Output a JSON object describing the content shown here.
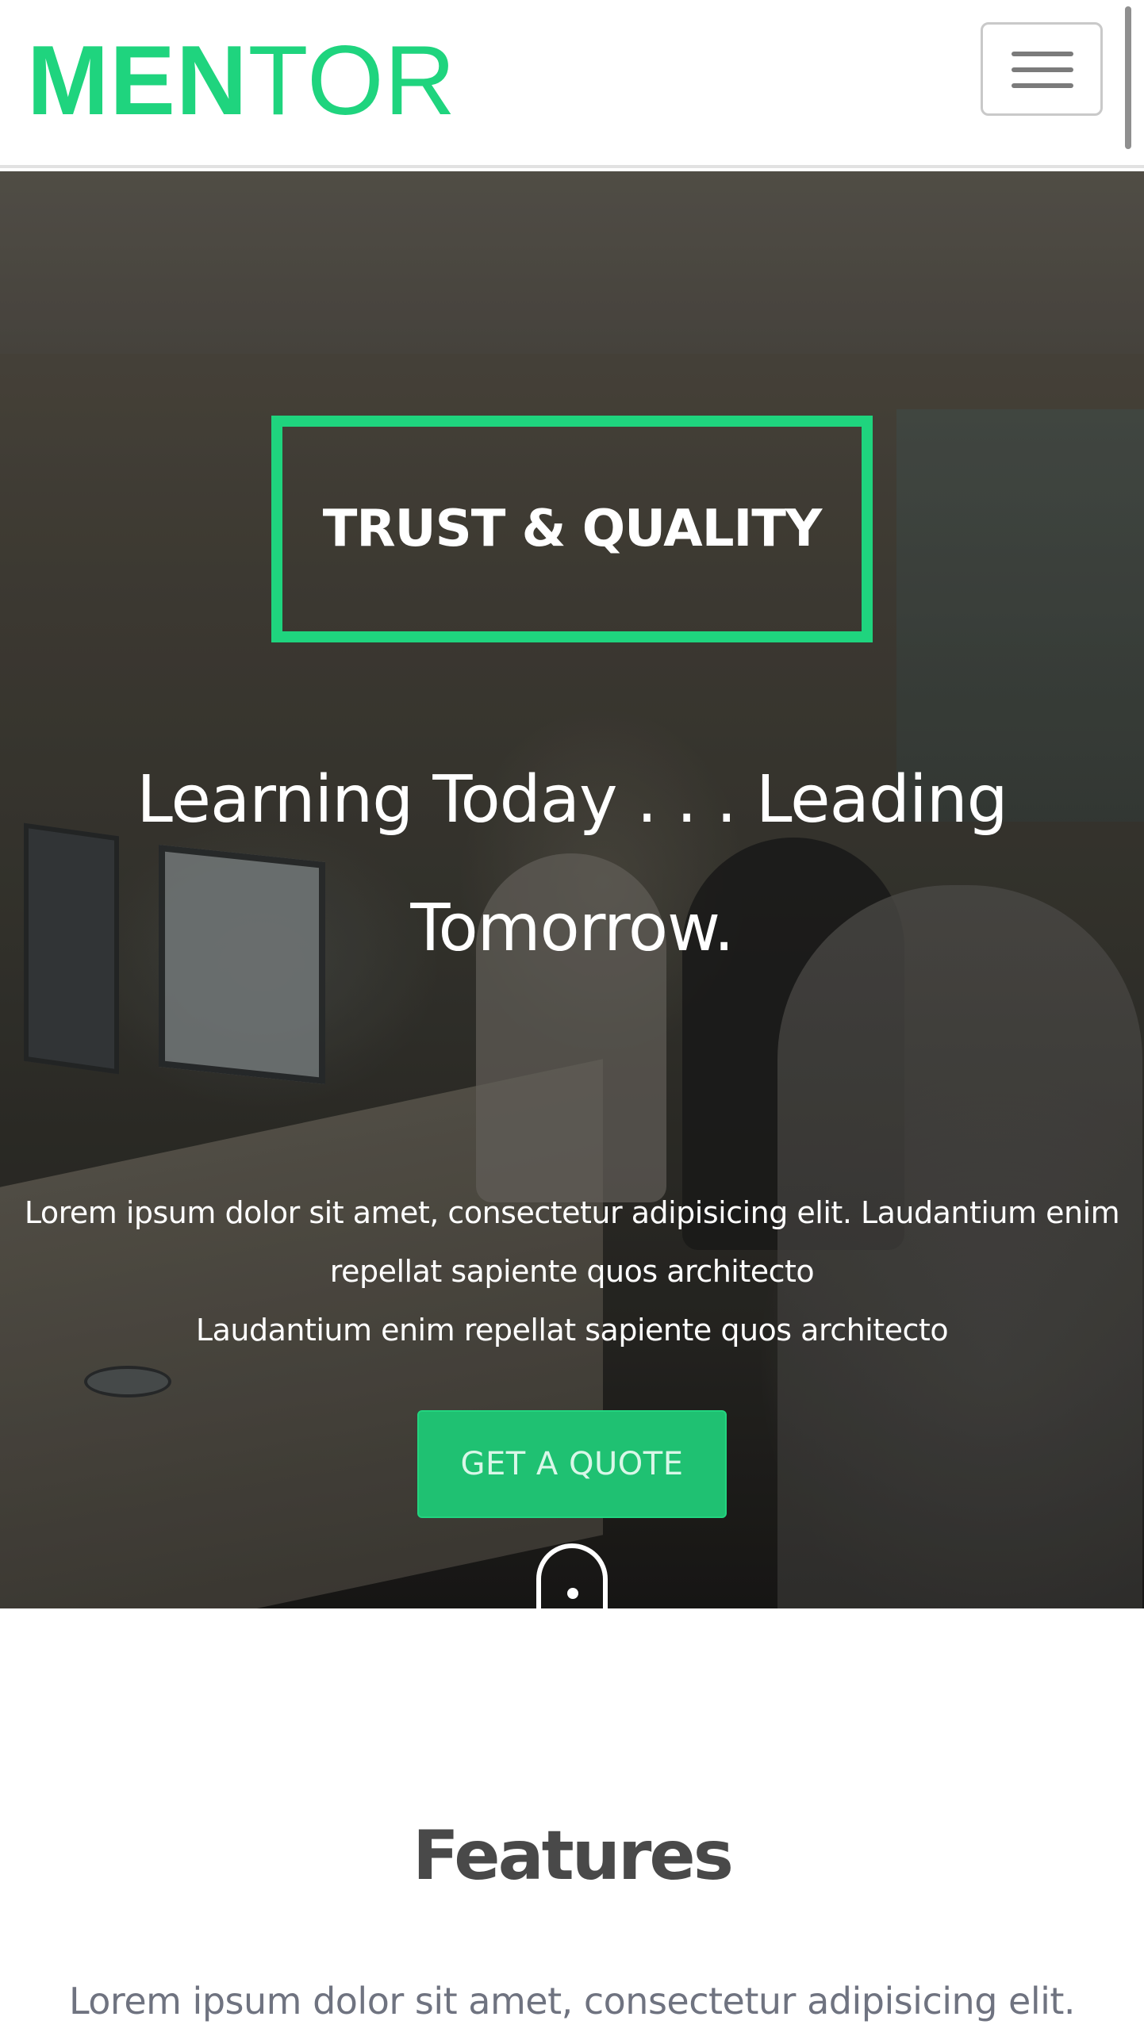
{
  "header": {
    "brand_bold": "MEN",
    "brand_light": "TOR",
    "menu_toggle_label": "Toggle navigation"
  },
  "hero": {
    "badge": "TRUST & QUALITY",
    "title_line1": "Learning Today . . . Leading",
    "title_line2": "Tomorrow.",
    "sub_line1": "Lorem ipsum dolor sit amet, consectetur adipisicing elit. Laudantium enim",
    "sub_line2": "repellat sapiente quos architecto",
    "sub_line3": "Laudantium enim repellat sapiente quos architecto",
    "cta_label": "GET A QUOTE",
    "scroll_icon": "mouse-scroll-icon"
  },
  "features": {
    "title": "Features",
    "subtitle": "Lorem ipsum dolor sit amet, consectetur adipisicing elit."
  },
  "colors": {
    "accent": "#1fd47e",
    "button": "#1fc172",
    "heading": "#494949",
    "muted_text": "#6f7380"
  },
  "icons": {
    "menu": "hamburger-menu-icon",
    "scroll": "mouse-scroll-icon"
  }
}
